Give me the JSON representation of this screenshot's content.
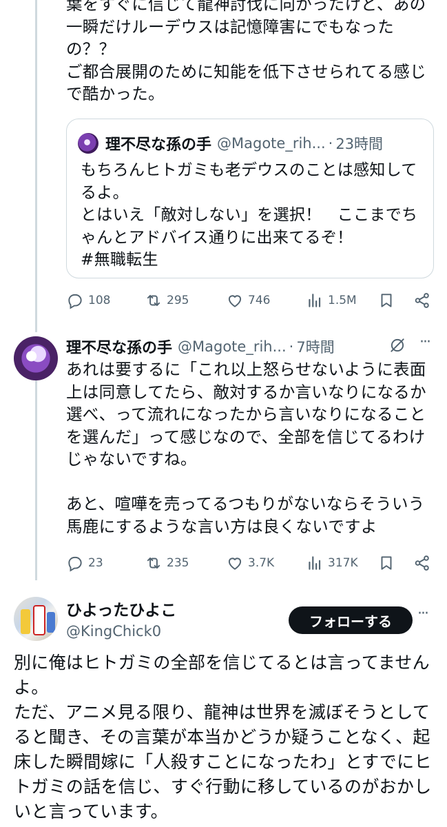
{
  "tweet1": {
    "text": "葉をすぐに信じて龍神討伐に向かったけど、あの一瞬だけルーデウスは記憶障害にでもなったの？？\nご都合展開のために知能を低下させられてる感じで酷かった。",
    "quote": {
      "name": "理不尽な孫の手",
      "handle": "@Magote_rih...",
      "dot": "·",
      "time": "23時間",
      "text": "もちろんヒトガミも老デウスのことは感知してるよ。\nとはいえ「敵対しない」を選択！　ここまでちゃんとアドバイス通りに出来てるぞ！\n#無職転生"
    },
    "stats": {
      "replies": "108",
      "reposts": "295",
      "likes": "746",
      "views": "1.5M"
    }
  },
  "tweet2": {
    "name": "理不尽な孫の手",
    "handle": "@Magote_rih...",
    "dot": "·",
    "time": "7時間",
    "more": "···",
    "text": "あれは要するに「これ以上怒らせないように表面上は同意してたら、敵対するか言いなりになるか選べ、って流れになったから言いなりになることを選んだ」って感じなので、全部を信じてるわけじゃないですね。\n\nあと、喧嘩を売ってるつもりがないならそういう馬鹿にするような言い方は良くないですよ",
    "stats": {
      "replies": "23",
      "reposts": "235",
      "likes": "3.7K",
      "views": "317K"
    }
  },
  "tweet3": {
    "name": "ひよったひよこ",
    "handle": "@KingChick0",
    "follow_label": "フォローする",
    "more": "···",
    "text": "別に俺はヒトガミの全部を信じてるとは言ってませんよ。\nただ、アニメ見る限り、龍神は世界を滅ぼそうとしてると聞き、その言葉が本当かどうか疑うことなく、起床した瞬間嫁に「人殺すことになったわ」とすでにヒトガミの話を信じ、すぐ行動に移しているのがおかしいと言っています。"
  },
  "colors": {
    "text": "#0f1419",
    "secondary": "#536471",
    "border": "#cfd9de",
    "button_bg": "#0f1419"
  },
  "icons": [
    "reply-icon",
    "repost-icon",
    "like-icon",
    "views-icon",
    "bookmark-icon",
    "share-icon",
    "grok-icon",
    "more-icon"
  ]
}
